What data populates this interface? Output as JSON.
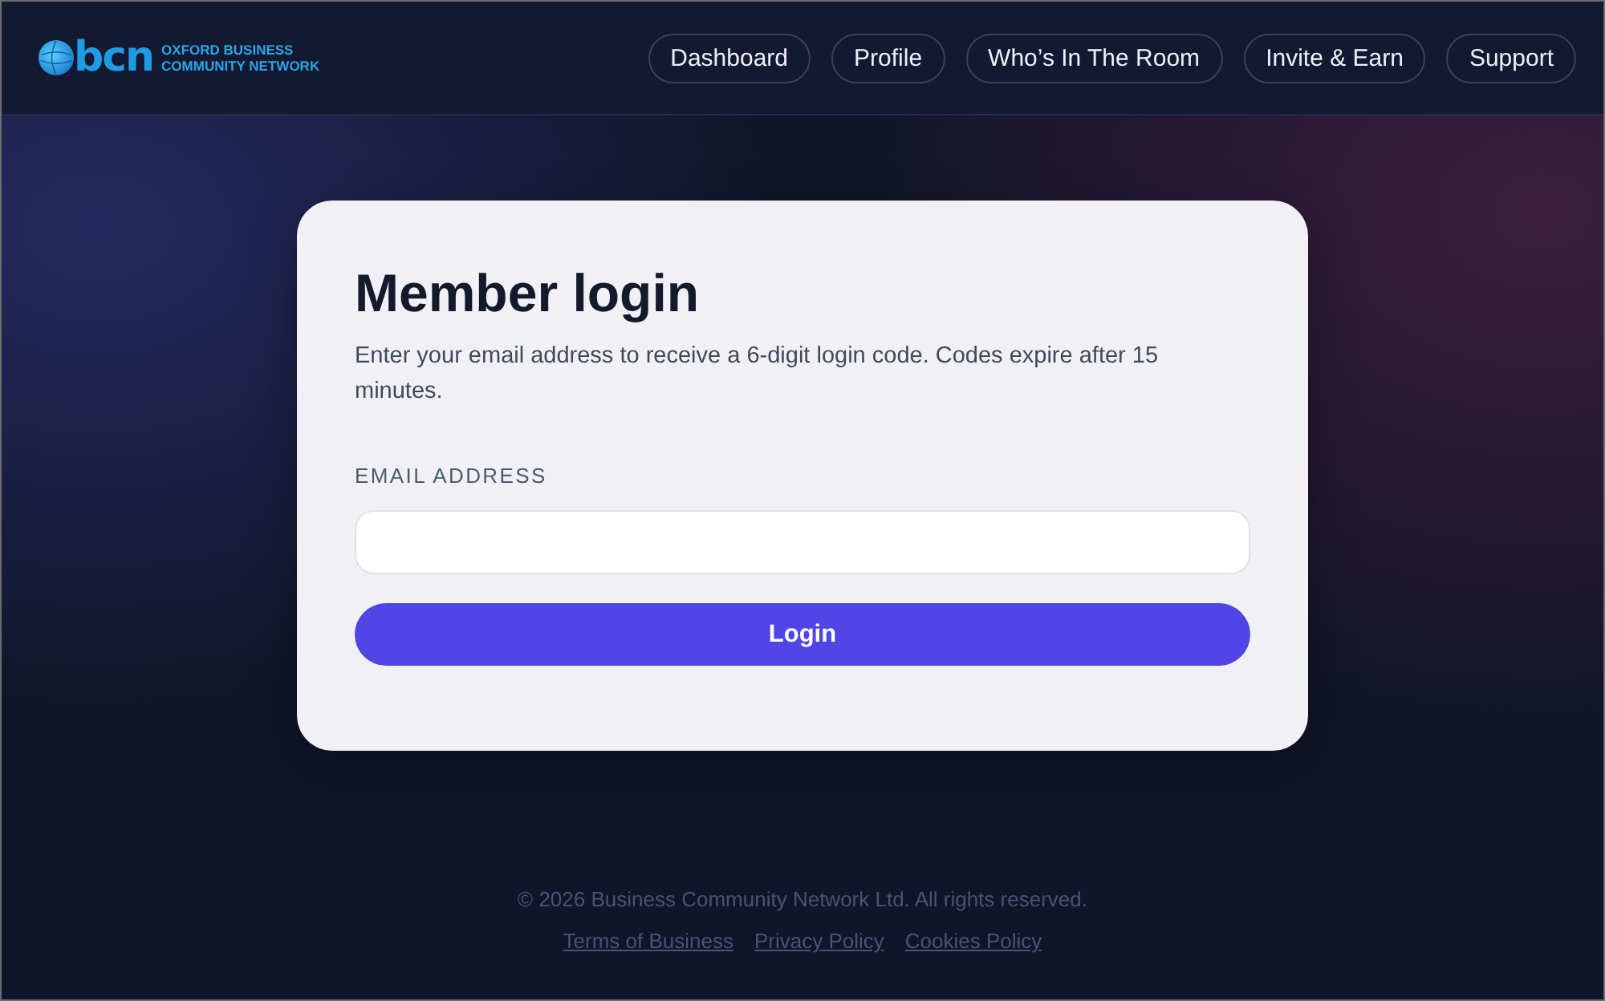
{
  "header": {
    "logo": {
      "mark": "bcn",
      "name_lines": [
        "OXFORD BUSINESS",
        "COMMUNITY NETWORK"
      ]
    },
    "nav": [
      "Dashboard",
      "Profile",
      "Who’s In The Room",
      "Invite & Earn",
      "Support"
    ]
  },
  "login_card": {
    "title": "Member login",
    "description": "Enter your email address to receive a 6-digit login code. Codes expire after 15 minutes.",
    "email_field": {
      "label": "EMAIL ADDRESS"
    },
    "submit_button": "Login"
  },
  "footer": {
    "copyright": "© 2026 Business Community Network Ltd. All rights reserved.",
    "links": [
      "Terms of Business",
      "Privacy Policy",
      "Cookies Policy"
    ]
  }
}
